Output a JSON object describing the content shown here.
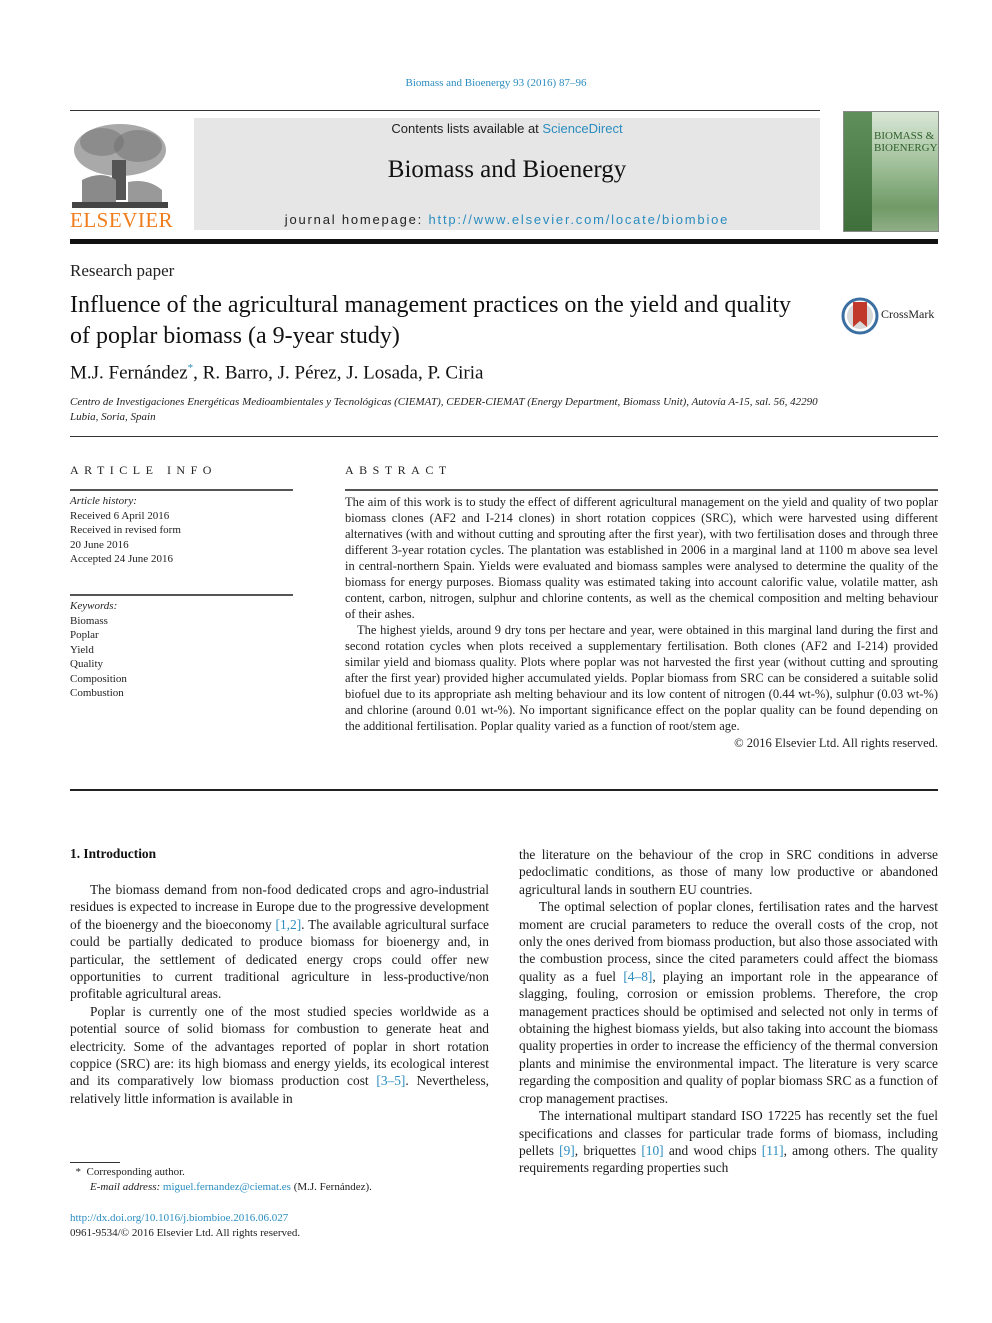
{
  "header": {
    "running_head": "Biomass and Bioenergy 93 (2016) 87–96",
    "publisher_logo_text": "ELSEVIER",
    "contents_prefix": "Contents lists available at ",
    "contents_link": "ScienceDirect",
    "journal_name": "Biomass and Bioenergy",
    "homepage_prefix": "journal homepage: ",
    "homepage_link": "http://www.elsevier.com/locate/biombioe",
    "cover_title_line1": "BIOMASS &",
    "cover_title_line2": "BIOENERGY"
  },
  "article": {
    "type": "Research paper",
    "title": "Influence of the agricultural management practices on the yield and quality of poplar biomass (a 9-year study)",
    "crossmark_label": "CrossMark",
    "authors": [
      {
        "name": "M.J. Fernández",
        "mark": "*"
      },
      {
        "name": "R. Barro"
      },
      {
        "name": "J. Pérez"
      },
      {
        "name": "J. Losada"
      },
      {
        "name": "P. Ciria"
      }
    ],
    "affiliation": "Centro de Investigaciones Energéticas Medioambientales y Tecnológicas (CIEMAT), CEDER-CIEMAT (Energy Department, Biomass Unit), Autovía A-15, sal. 56, 42290 Lubia, Soria, Spain"
  },
  "article_info": {
    "section_label": "ARTICLE INFO",
    "history_heading": "Article history:",
    "history": [
      "Received 6 April 2016",
      "Received in revised form",
      "20 June 2016",
      "Accepted 24 June 2016"
    ],
    "keywords_heading": "Keywords:",
    "keywords": [
      "Biomass",
      "Poplar",
      "Yield",
      "Quality",
      "Composition",
      "Combustion"
    ]
  },
  "abstract": {
    "section_label": "ABSTRACT",
    "paragraphs": [
      "The aim of this work is to study the effect of different agricultural management on the yield and quality of two poplar biomass clones (AF2 and I-214 clones) in short rotation coppices (SRC), which were harvested using different alternatives (with and without cutting and sprouting after the first year), with two fertilisation doses and through three different 3-year rotation cycles. The plantation was established in 2006 in a marginal land at 1100 m above sea level in central-northern Spain. Yields were evaluated and biomass samples were analysed to determine the quality of the biomass for energy purposes. Biomass quality was estimated taking into account calorific value, volatile matter, ash content, carbon, nitrogen, sulphur and chlorine contents, as well as the chemical composition and melting behaviour of their ashes.",
      "The highest yields, around 9 dry tons per hectare and year, were obtained in this marginal land during the first and second rotation cycles when plots received a supplementary fertilisation. Both clones (AF2 and I-214) provided similar yield and biomass quality. Plots where poplar was not harvested the first year (without cutting and sprouting after the first year) provided higher accumulated yields. Poplar biomass from SRC can be considered a suitable solid biofuel due to its appropriate ash melting behaviour and its low content of nitrogen (0.44 wt-%), sulphur (0.03 wt-%) and chlorine (around 0.01 wt-%). No important significance effect on the poplar quality can be found depending on the additional fertilisation. Poplar quality varied as a function of root/stem age."
    ],
    "copyright": "© 2016 Elsevier Ltd. All rights reserved."
  },
  "body": {
    "intro_heading": "1.  Introduction",
    "left_p1_a": "The biomass demand from non-food dedicated crops and agro-industrial residues is expected to increase in Europe due to the progressive development of the bioenergy and the bioeconomy ",
    "left_p1_ref": "[1,2]",
    "left_p1_b": ". The available agricultural surface could be partially dedicated to produce biomass for bioenergy and, in particular, the settlement of dedicated energy crops could offer new opportunities to current traditional agriculture in less-productive/non profitable agricultural areas.",
    "left_p2_a": "Poplar is currently one of the most studied species worldwide as a potential source of solid biomass for combustion to generate heat and electricity. Some of the advantages reported of poplar in short rotation coppice (SRC) are: its high biomass and energy yields, its ecological interest and its comparatively low biomass production cost ",
    "left_p2_ref": "[3–5]",
    "left_p2_b": ". Nevertheless, relatively little information is available in",
    "right_p0": "the literature on the behaviour of the crop in SRC conditions in adverse pedoclimatic conditions, as those of many low productive or abandoned agricultural lands in southern EU countries.",
    "right_p1_a": "The optimal selection of poplar clones, fertilisation rates and the harvest moment are crucial parameters to reduce the overall costs of the crop, not only the ones derived from biomass production, but also those associated with the combustion process, since the cited parameters could affect the biomass quality as a fuel ",
    "right_p1_ref": "[4–8]",
    "right_p1_b": ", playing an important role in the appearance of slagging, fouling, corrosion or emission problems. Therefore, the crop management practices should be optimised and selected not only in terms of obtaining the highest biomass yields, but also taking into account the biomass quality properties in order to increase the efficiency of the thermal conversion plants and minimise the environmental impact. The literature is very scarce regarding the composition and quality of poplar biomass SRC as a function of crop management practises.",
    "right_p2_a": "The international multipart standard ISO 17225 has recently set the fuel specifications and classes for particular trade forms of biomass, including pellets ",
    "right_p2_ref1": "[9]",
    "right_p2_b": ", briquettes ",
    "right_p2_ref2": "[10]",
    "right_p2_c": " and wood chips ",
    "right_p2_ref3": "[11]",
    "right_p2_d": ", among others. The quality requirements regarding properties such"
  },
  "footer": {
    "fn_mark": "*",
    "fn_corresponding": "Corresponding author.",
    "fn_email_label": "E-mail address: ",
    "fn_email": "miguel.fernandez@ciemat.es",
    "fn_email_owner": " (M.J. Fernández).",
    "doi": "http://dx.doi.org/10.1016/j.biombioe.2016.06.027",
    "issn_line": "0961-9534/© 2016 Elsevier Ltd. All rights reserved."
  },
  "colors": {
    "link": "#2a8cbf",
    "elsevier_orange": "#f07c1b",
    "masthead_bg": "#e6e6e6"
  }
}
